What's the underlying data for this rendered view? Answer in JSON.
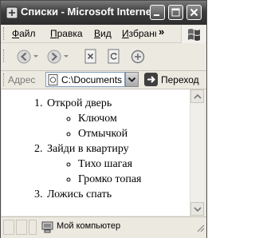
{
  "window": {
    "title": "Списки - Microsoft Internet Explorer",
    "controls": [
      "minimize",
      "maximize",
      "close"
    ]
  },
  "menu": {
    "items": [
      {
        "underline": "Ф",
        "rest": "айл"
      },
      {
        "underline": "П",
        "rest": "равка"
      },
      {
        "underline": "В",
        "rest": "ид"
      },
      {
        "underline": "И",
        "rest": "збранное"
      }
    ],
    "overflow": "»"
  },
  "toolbar": {
    "buttons": [
      "back-icon",
      "forward-icon",
      "stop-icon",
      "refresh-icon",
      "home-icon"
    ]
  },
  "address": {
    "label_underline": "д",
    "label_pre": "А",
    "label_post": "рес",
    "value": "C:\\Documents and Settings",
    "go_label": "Переход"
  },
  "content": {
    "items": [
      {
        "text": "Открой дверь",
        "children": [
          "Ключом",
          "Отмычкой"
        ]
      },
      {
        "text": "Зайди в квартиру",
        "children": [
          "Тихо шагая",
          "Громко топая"
        ]
      },
      {
        "text": "Ложись спать",
        "children": []
      }
    ]
  },
  "status": {
    "zone_text": "Мой компьютер"
  },
  "colors": {
    "titlebar": "#3d3d3d",
    "chrome": "#ece9e0",
    "content_bg": "#ffffff"
  }
}
